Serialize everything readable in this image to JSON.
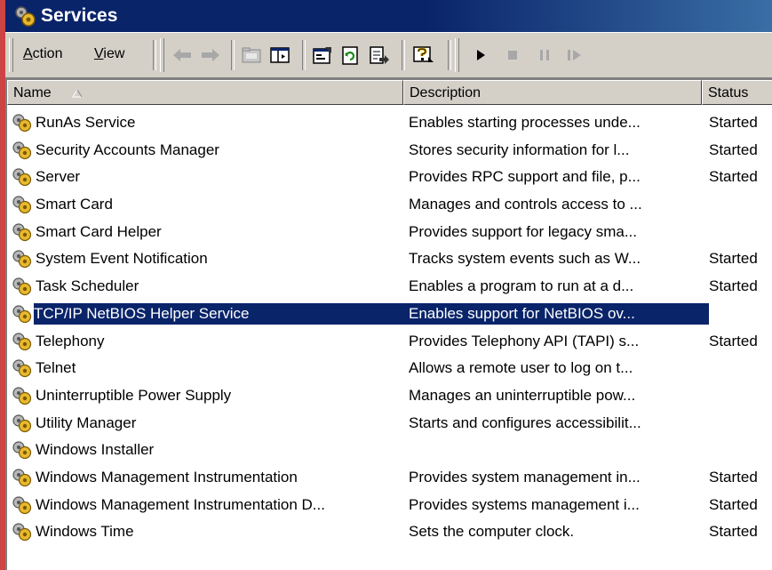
{
  "window": {
    "title": "Services",
    "icon": "services-gear-icon"
  },
  "toolbar": {
    "menus": [
      {
        "label": "Action",
        "underline": "A",
        "rest": "ction"
      },
      {
        "label": "View",
        "underline": "V",
        "rest": "iew"
      }
    ],
    "buttons": [
      "back-arrow-icon",
      "forward-arrow-icon",
      "up-folder-icon",
      "show-hide-tree-icon",
      "properties-icon",
      "refresh-icon",
      "export-list-icon",
      "help-icon",
      "start-service-icon",
      "stop-service-icon",
      "pause-service-icon",
      "restart-service-icon"
    ]
  },
  "columns": {
    "name": "Name",
    "description": "Description",
    "status": "Status"
  },
  "rows": [
    {
      "name": "RunAs Service",
      "description": "Enables starting processes unde...",
      "status": "Started"
    },
    {
      "name": "Security Accounts Manager",
      "description": "Stores security information for l...",
      "status": "Started"
    },
    {
      "name": "Server",
      "description": "Provides RPC support and file, p...",
      "status": "Started"
    },
    {
      "name": "Smart Card",
      "description": "Manages and controls access to ...",
      "status": ""
    },
    {
      "name": "Smart Card Helper",
      "description": "Provides support for legacy sma...",
      "status": ""
    },
    {
      "name": "System Event Notification",
      "description": "Tracks system events such as W...",
      "status": "Started"
    },
    {
      "name": "Task Scheduler",
      "description": "Enables a program to run at a d...",
      "status": "Started"
    },
    {
      "name": "TCP/IP NetBIOS Helper Service",
      "description": "Enables support for NetBIOS ov...",
      "status": "",
      "selected": true
    },
    {
      "name": "Telephony",
      "description": "Provides Telephony API (TAPI) s...",
      "status": "Started"
    },
    {
      "name": "Telnet",
      "description": "Allows a remote user to log on t...",
      "status": ""
    },
    {
      "name": "Uninterruptible Power Supply",
      "description": "Manages an uninterruptible pow...",
      "status": ""
    },
    {
      "name": "Utility Manager",
      "description": "Starts and configures accessibilit...",
      "status": ""
    },
    {
      "name": "Windows Installer",
      "description": "",
      "status": ""
    },
    {
      "name": "Windows Management Instrumentation",
      "description": "Provides system management in...",
      "status": "Started"
    },
    {
      "name": "Windows Management Instrumentation D...",
      "description": "Provides systems management i...",
      "status": "Started"
    },
    {
      "name": "Windows Time",
      "description": "Sets the computer clock.",
      "status": "Started"
    }
  ],
  "colors": {
    "selection": "#0a246a",
    "face": "#d4d0c8",
    "titlebar": "#0a246a"
  }
}
